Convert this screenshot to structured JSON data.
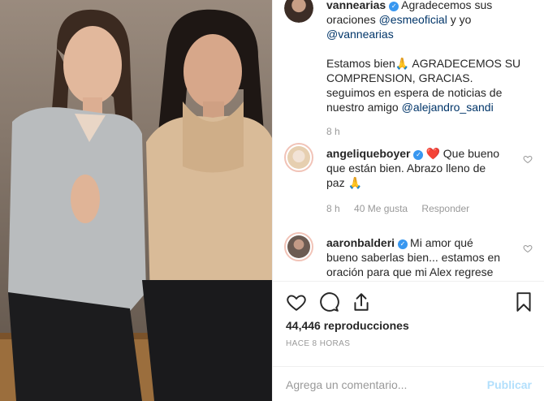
{
  "post": {
    "caption_user": "vannearias",
    "caption_lines": [
      "Agradecemos sus",
      "oraciones",
      "y yo",
      "Estamos bien🙏 AGRADECEMOS SU",
      "COMPRENSION, GRACIAS.",
      "seguimos en espera de noticias de",
      "nuestro amigo"
    ],
    "mentions": [
      "@esmeoficial",
      "@vannearias",
      "@alejandro_sandi"
    ],
    "caption_time": "8 h"
  },
  "comments": [
    {
      "user": "angeliqueboyer",
      "lines": [
        "❤️ Que bueno",
        "que están bien. Abrazo lleno de",
        "paz 🙏"
      ],
      "time": "8 h",
      "likes": "40 Me gusta",
      "reply": "Responder"
    },
    {
      "user": "aaronbalderi",
      "lines": [
        "Mi amor qué",
        "bueno saberlas bien... estamos en",
        "oración para que mi Alex regrese"
      ]
    }
  ],
  "stats": {
    "views": "44,446 reproducciones",
    "time": "HACE 8 HORAS"
  },
  "composer": {
    "placeholder": "Agrega un comentario...",
    "publish": "Publicar"
  },
  "icons": [
    "heart-icon",
    "comment-icon",
    "share-icon",
    "bookmark-icon",
    "verified-icon"
  ],
  "colors": {
    "link": "#003569",
    "verified": "#3897f0",
    "publish": "#b2dffc",
    "meta": "#999999"
  }
}
